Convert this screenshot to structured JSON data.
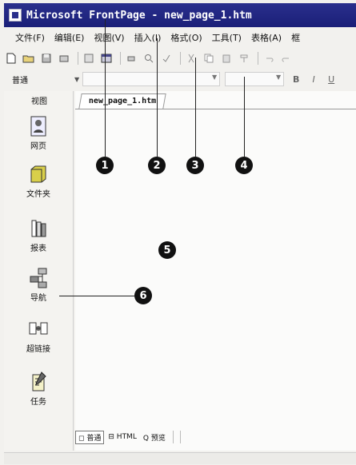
{
  "window": {
    "title": "Microsoft FrontPage - new_page_1.htm"
  },
  "menu": {
    "items": [
      "文件(F)",
      "编辑(E)",
      "视图(V)",
      "插入(I)",
      "格式(O)",
      "工具(T)",
      "表格(A)",
      "框"
    ]
  },
  "toolbar": {
    "style_label": "普通"
  },
  "views_panel": {
    "title": "视图",
    "items": [
      {
        "label": "网页",
        "icon": "page-view-icon"
      },
      {
        "label": "文件夹",
        "icon": "folder-icon"
      },
      {
        "label": "报表",
        "icon": "reports-icon"
      },
      {
        "label": "导航",
        "icon": "navigation-icon"
      },
      {
        "label": "超链接",
        "icon": "hyperlinks-icon"
      },
      {
        "label": "任务",
        "icon": "tasks-icon"
      }
    ]
  },
  "editor": {
    "tab_label": "new_page_1.htm",
    "view_tabs": {
      "normal": "普通",
      "html": "HTML",
      "preview": "预览"
    }
  },
  "callouts": [
    "1",
    "2",
    "3",
    "4",
    "5",
    "6"
  ]
}
